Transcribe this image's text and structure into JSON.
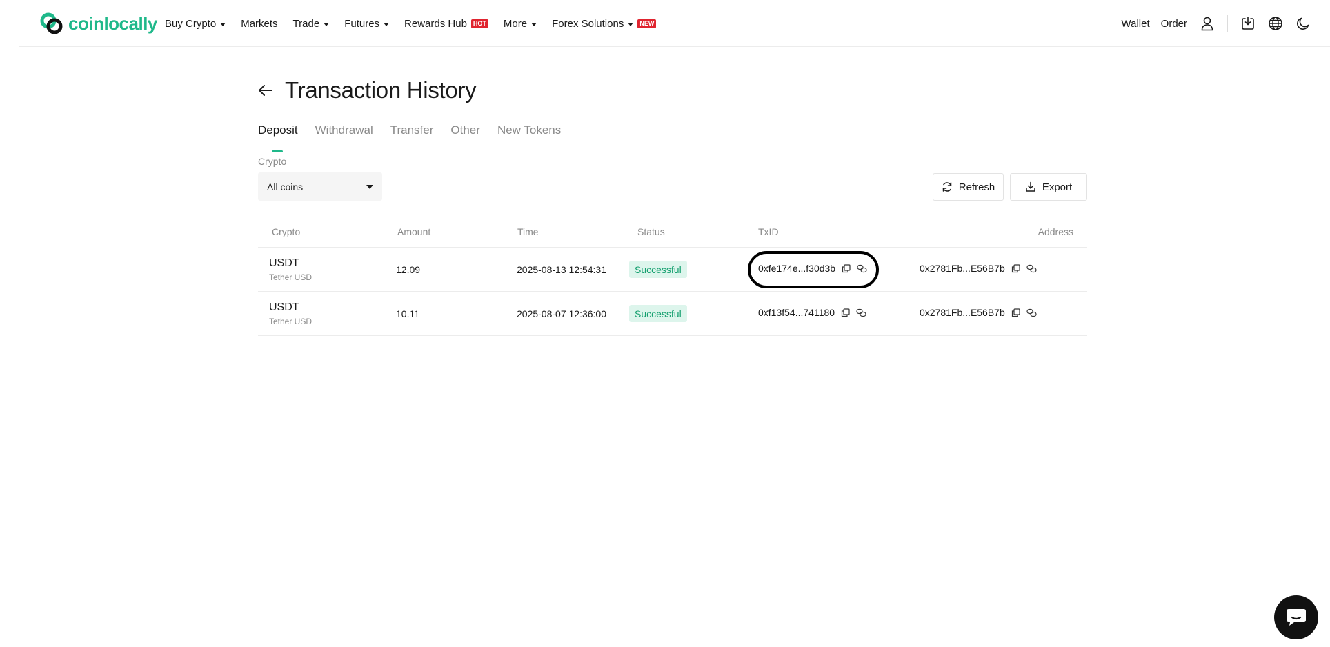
{
  "colors": {
    "brand": "#1fb88a",
    "success_bg": "#ddf5ec",
    "success_text": "#15a06f",
    "hot_badge": "#e0242f"
  },
  "nav": {
    "logo_text": "coinlocally",
    "items": [
      {
        "label": "Buy Crypto",
        "dropdown": true,
        "badge": ""
      },
      {
        "label": "Markets",
        "dropdown": false,
        "badge": ""
      },
      {
        "label": "Trade",
        "dropdown": true,
        "badge": ""
      },
      {
        "label": "Futures",
        "dropdown": true,
        "badge": ""
      },
      {
        "label": "Rewards Hub",
        "dropdown": false,
        "badge": "HOT"
      },
      {
        "label": "More",
        "dropdown": true,
        "badge": ""
      },
      {
        "label": "Forex Solutions",
        "dropdown": true,
        "badge": "NEW"
      }
    ],
    "right": {
      "wallet": "Wallet",
      "order": "Order"
    },
    "icons": [
      "user-icon",
      "download-icon",
      "globe-icon",
      "moon-icon"
    ]
  },
  "page": {
    "title": "Transaction History",
    "tabs": [
      "Deposit",
      "Withdrawal",
      "Transfer",
      "Other",
      "New Tokens"
    ],
    "active_tab": "Deposit",
    "filter": {
      "label": "Crypto",
      "value": "All coins"
    },
    "buttons": {
      "refresh": "Refresh",
      "export": "Export"
    }
  },
  "table": {
    "headers": {
      "crypto": "Crypto",
      "amount": "Amount",
      "time": "Time",
      "status": "Status",
      "txid": "TxID",
      "address": "Address"
    },
    "rows": [
      {
        "symbol": "USDT",
        "name": "Tether USD",
        "amount": "12.09",
        "time": "2025-08-13 12:54:31",
        "status": "Successful",
        "txid": "0xfe174e...f30d3b",
        "address": "0x2781Fb...E56B7b"
      },
      {
        "symbol": "USDT",
        "name": "Tether USD",
        "amount": "10.11",
        "time": "2025-08-07 12:36:00",
        "status": "Successful",
        "txid": "0xf13f54...741180",
        "address": "0x2781Fb...E56B7b"
      }
    ]
  }
}
